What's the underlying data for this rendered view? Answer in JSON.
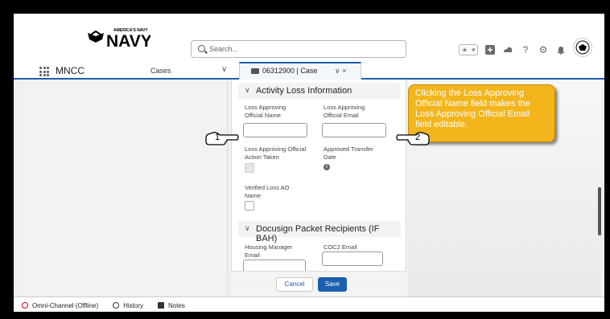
{
  "header": {
    "logo_text": "AMERICA'S NAVY",
    "search_placeholder": "Search...",
    "icons": [
      "star-icon",
      "chevron-down-icon",
      "plus-icon",
      "cloud-icon",
      "help-icon",
      "gear-icon",
      "bell-icon"
    ]
  },
  "nav": {
    "app_name": "MNCC",
    "tab_cases": "Cases",
    "case_tab_label": "06312900 | Case",
    "case_tab_controls": "∨ ×"
  },
  "sections": {
    "activity_loss": "Activity Loss Information",
    "docusign": "Docusign Packet Recipients (IF BAH)"
  },
  "fields": {
    "loss_approving_name": "Loss Approving Official Name",
    "loss_approving_email": "Loss Approving Official Email",
    "loss_action_taken": "Loss Approving Official Action Taken",
    "approved_transfer_date": "Approved Transfer Date",
    "verified_loss_ao_name": "Verified Loss AO Name",
    "housing_manager_email": "Housing Manager Email",
    "coc2_email": "COC2 Email"
  },
  "buttons": {
    "cancel": "Cancel",
    "save": "Save"
  },
  "utility_bar": {
    "omni_channel": "Omni-Channel (Offline)",
    "history": "History",
    "notes": "Notes"
  },
  "annotation": {
    "callout_text": "Clicking the Loss Approving Official Name field makes the Loss Approving Official Email field editable.",
    "marker_1": "1",
    "marker_2": "2"
  },
  "colors": {
    "brand_blue": "#1b5fb0",
    "callout_yellow": "#f3b51c",
    "offline_red": "#d0021b"
  }
}
